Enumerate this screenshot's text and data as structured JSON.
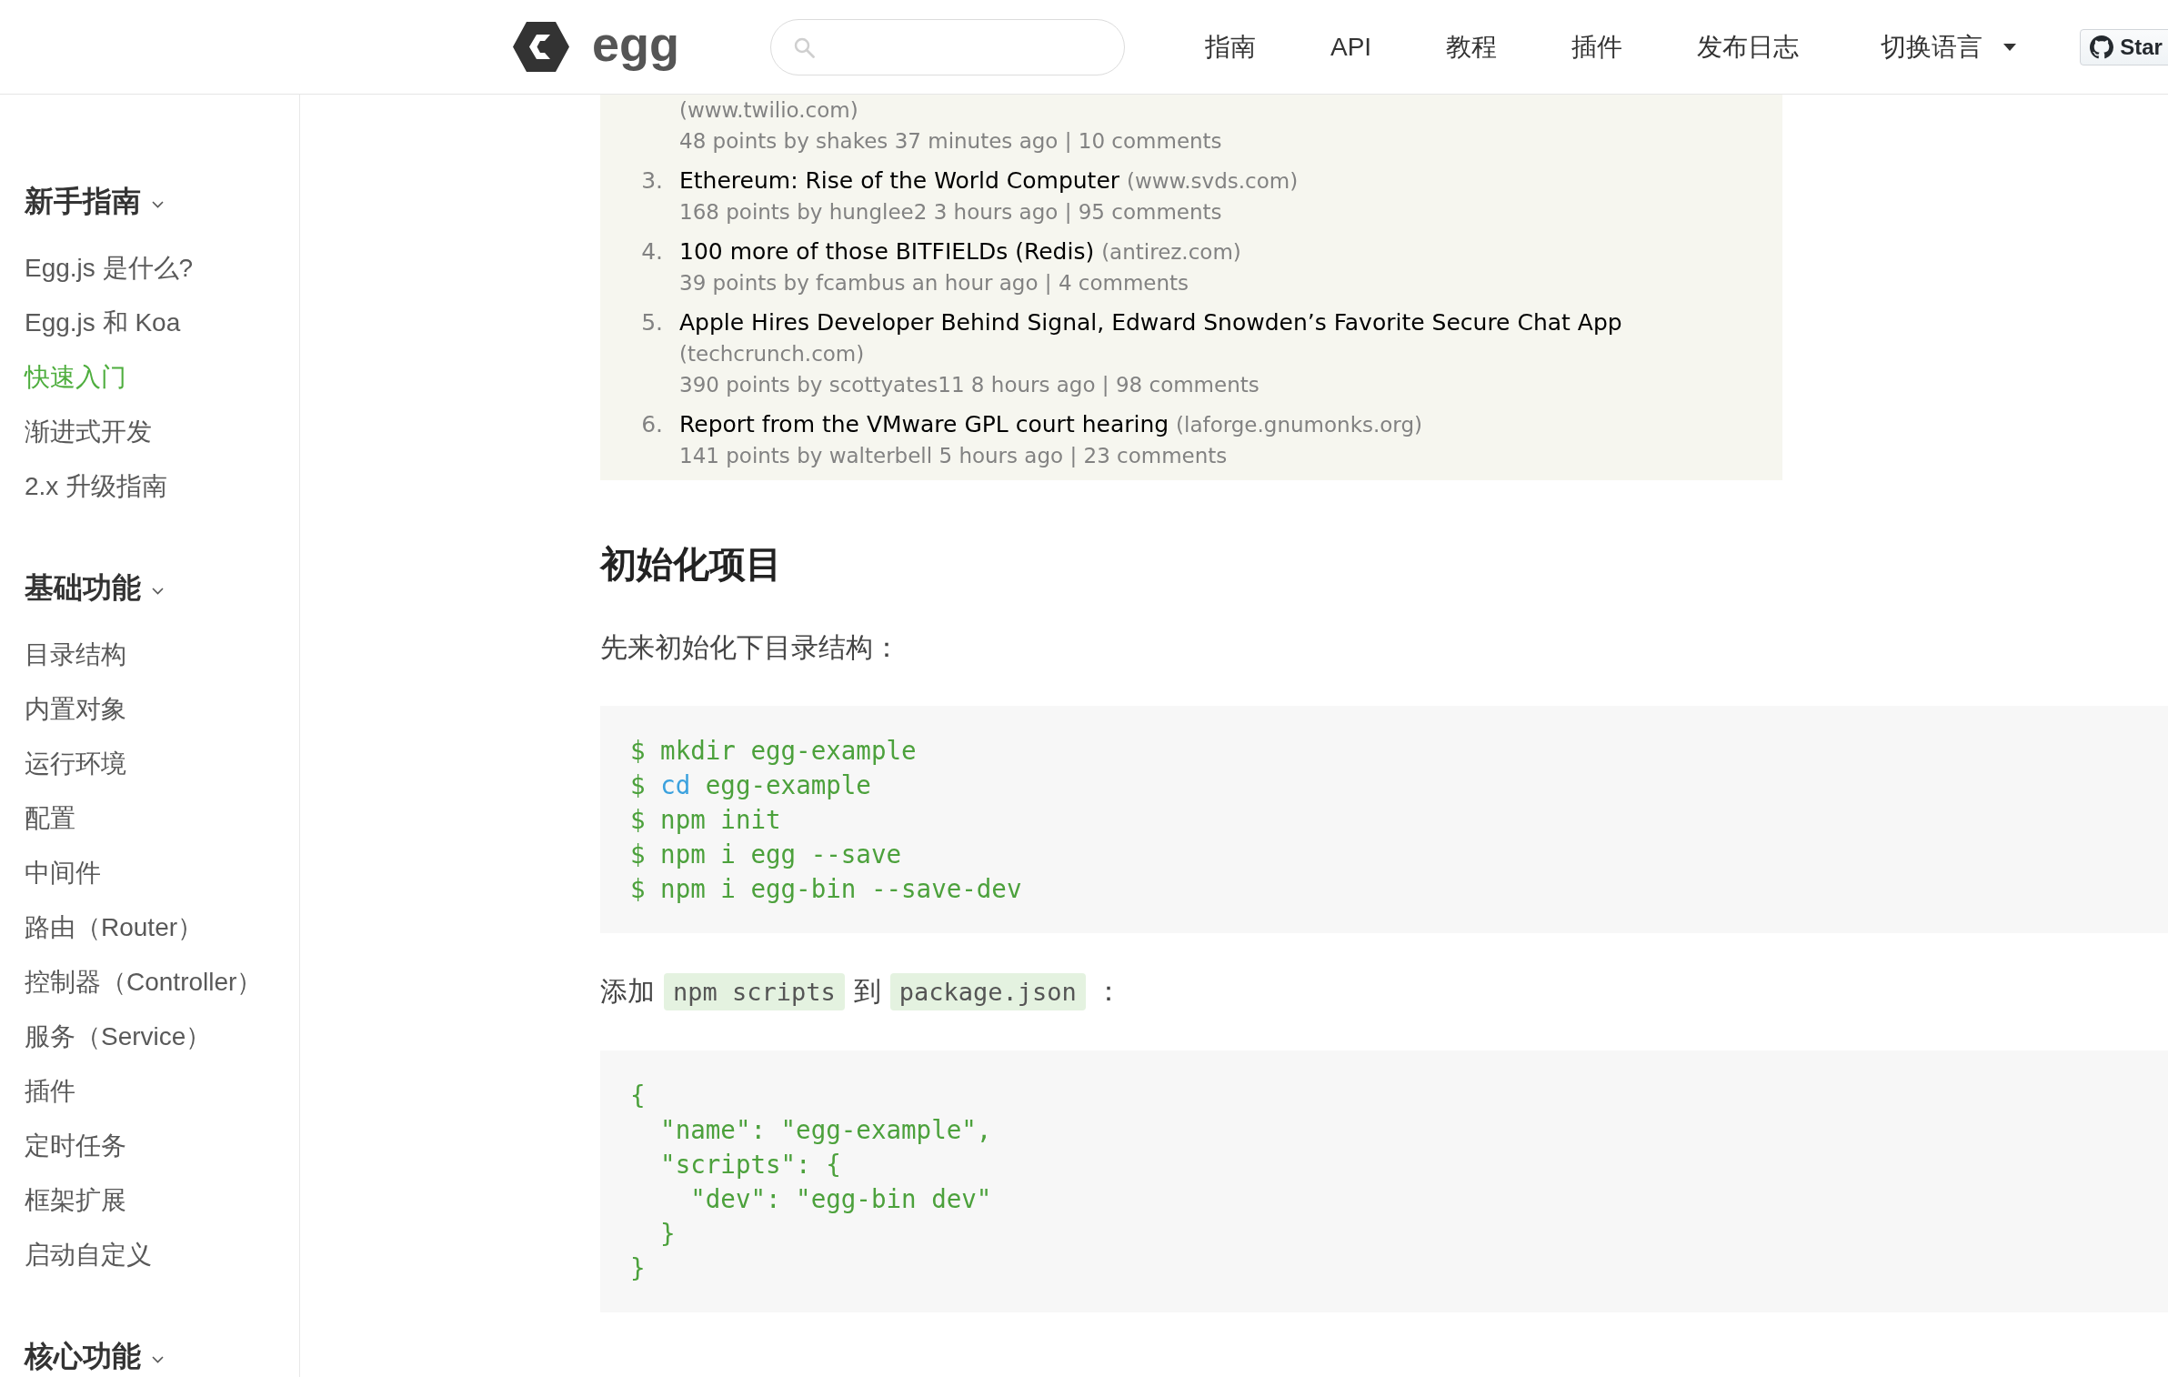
{
  "header": {
    "logo": {
      "text": "egg"
    },
    "nav": [
      {
        "label": "指南",
        "kind": "link"
      },
      {
        "label": "API",
        "kind": "link"
      },
      {
        "label": "教程",
        "kind": "link"
      },
      {
        "label": "插件",
        "kind": "link"
      },
      {
        "label": "发布日志",
        "kind": "link"
      },
      {
        "label": "切换语言",
        "kind": "dropdown"
      }
    ],
    "star_button": {
      "label": "Star"
    }
  },
  "sidebar": {
    "groups": [
      {
        "title": "新手指南",
        "items": [
          {
            "label": "Egg.js 是什么?",
            "selected": false
          },
          {
            "label": "Egg.js 和 Koa",
            "selected": false
          },
          {
            "label": "快速入门",
            "selected": true
          },
          {
            "label": "渐进式开发",
            "selected": false
          },
          {
            "label": "2.x 升级指南",
            "selected": false
          }
        ]
      },
      {
        "title": "基础功能",
        "items": [
          {
            "label": "目录结构",
            "selected": false
          },
          {
            "label": "内置对象",
            "selected": false
          },
          {
            "label": "运行环境",
            "selected": false
          },
          {
            "label": "配置",
            "selected": false
          },
          {
            "label": "中间件",
            "selected": false
          },
          {
            "label": "路由（Router）",
            "selected": false
          },
          {
            "label": "控制器（Controller）",
            "selected": false
          },
          {
            "label": "服务（Service）",
            "selected": false
          },
          {
            "label": "插件",
            "selected": false
          },
          {
            "label": "定时任务",
            "selected": false
          },
          {
            "label": "框架扩展",
            "selected": false
          },
          {
            "label": "启动自定义",
            "selected": false
          }
        ]
      },
      {
        "title": "核心功能"
      }
    ]
  },
  "content": {
    "news_screenshot": {
      "items": [
        {
          "domain": "(www.twilio.com)",
          "meta": "48 points by shakes 37 minutes ago | 10 comments"
        },
        {
          "rank": "3.",
          "title": "Ethereum: Rise of the World Computer",
          "domain": "(www.svds.com)",
          "meta": "168 points by hunglee2 3 hours ago | 95 comments"
        },
        {
          "rank": "4.",
          "title": "100 more of those BITFIELDs (Redis)",
          "domain": "(antirez.com)",
          "meta": "39 points by fcambus an hour ago | 4 comments"
        },
        {
          "rank": "5.",
          "title": "Apple Hires Developer Behind Signal, Edward Snowden’s Favorite Secure Chat App",
          "domain": "(techcrunch.com)",
          "meta": "390 points by scottyates11 8 hours ago | 98 comments"
        },
        {
          "rank": "6.",
          "title": "Report from the VMware GPL court hearing",
          "domain": "(laforge.gnumonks.org)",
          "meta": "141 points by walterbell 5 hours ago | 23 comments"
        }
      ]
    },
    "blocks": [
      {
        "kind": "heading",
        "text": "初始化项目"
      },
      {
        "kind": "paragraph",
        "segments": [
          {
            "kind": "text",
            "text": "先来初始化下目录结构："
          }
        ]
      },
      {
        "kind": "code",
        "lines": [
          {
            "segments": [
              {
                "kind": "text",
                "text": "$ mkdir egg-example"
              }
            ]
          },
          {
            "segments": [
              {
                "kind": "text",
                "text": "$ "
              },
              {
                "kind": "builtin",
                "text": "cd"
              },
              {
                "kind": "text",
                "text": " egg-example"
              }
            ]
          },
          {
            "segments": [
              {
                "kind": "text",
                "text": "$ npm init"
              }
            ]
          },
          {
            "segments": [
              {
                "kind": "text",
                "text": "$ npm i egg --save"
              }
            ]
          },
          {
            "segments": [
              {
                "kind": "text",
                "text": "$ npm i egg-bin --save-dev"
              }
            ]
          }
        ]
      },
      {
        "kind": "paragraph",
        "segments": [
          {
            "kind": "text",
            "text": "添加"
          },
          {
            "kind": "code",
            "text": "npm scripts"
          },
          {
            "kind": "text",
            "text": "到"
          },
          {
            "kind": "code",
            "text": "package.json"
          },
          {
            "kind": "text",
            "text": "："
          }
        ]
      },
      {
        "kind": "code",
        "lines": [
          {
            "segments": [
              {
                "kind": "text",
                "text": "{"
              }
            ]
          },
          {
            "segments": [
              {
                "kind": "text",
                "text": "  \"name\": \"egg-example\","
              }
            ]
          },
          {
            "segments": [
              {
                "kind": "text",
                "text": "  \"scripts\": {"
              }
            ]
          },
          {
            "segments": [
              {
                "kind": "text",
                "text": "    \"dev\": \"egg-bin dev\""
              }
            ]
          },
          {
            "segments": [
              {
                "kind": "text",
                "text": "  }"
              }
            ]
          },
          {
            "segments": [
              {
                "kind": "text",
                "text": "}"
              }
            ]
          }
        ]
      }
    ]
  }
}
